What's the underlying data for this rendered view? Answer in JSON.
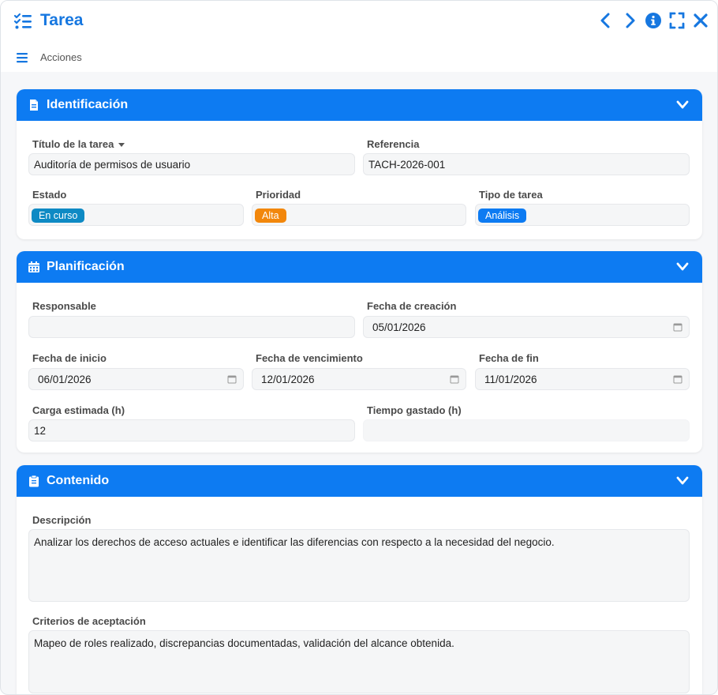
{
  "window": {
    "title": "Tarea",
    "actions_label": "Acciones"
  },
  "colors": {
    "accent": "#0d7bf2",
    "status_en_curso": "#0e8ac4",
    "priority_alta": "#f2870c",
    "type_analisis": "#0d7bf2"
  },
  "sections": {
    "identificacion": {
      "title": "Identificación",
      "titulo_label": "Título de la tarea",
      "titulo_value": "Auditoría de permisos de usuario",
      "referencia_label": "Referencia",
      "referencia_value": "TACH-2026-001",
      "estado_label": "Estado",
      "estado_value": "En curso",
      "prioridad_label": "Prioridad",
      "prioridad_value": "Alta",
      "tipo_label": "Tipo de tarea",
      "tipo_value": "Análisis"
    },
    "planificacion": {
      "title": "Planificación",
      "responsable_label": "Responsable",
      "responsable_value": "",
      "creacion_label": "Fecha de creación",
      "creacion_value": "05/01/2026",
      "inicio_label": "Fecha de inicio",
      "inicio_value": "06/01/2026",
      "vencimiento_label": "Fecha de vencimiento",
      "vencimiento_value": "12/01/2026",
      "fin_label": "Fecha de fin",
      "fin_value": "11/01/2026",
      "carga_label": "Carga estimada (h)",
      "carga_value": "12",
      "tiempo_label": "Tiempo gastado (h)",
      "tiempo_value": ""
    },
    "contenido": {
      "title": "Contenido",
      "descripcion_label": "Descripción",
      "descripcion_value": "Analizar los derechos de acceso actuales e identificar las diferencias con respecto a la necesidad del negocio.",
      "criterios_label": "Criterios de aceptación",
      "criterios_value": "Mapeo de roles realizado, discrepancias documentadas, validación del alcance obtenida."
    }
  }
}
